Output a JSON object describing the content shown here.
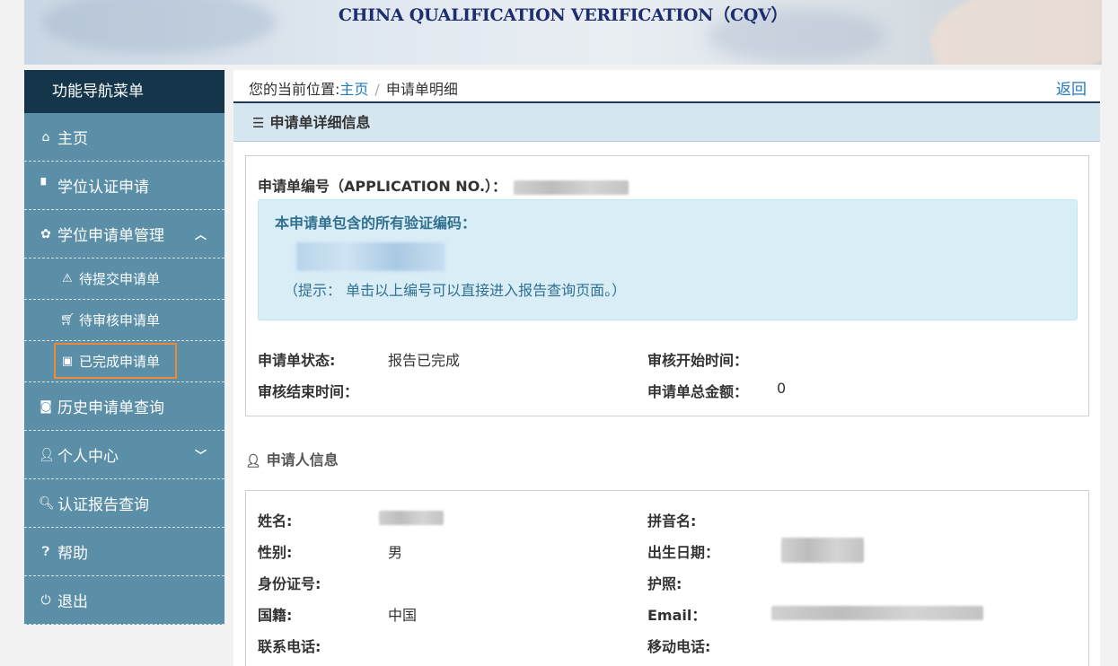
{
  "banner": {
    "title": "CHINA QUALIFICATION VERIFICATION（CQV）"
  },
  "sidebar": {
    "header": "功能导航菜单",
    "items": [
      {
        "label": "主页",
        "icon": "home-icon"
      },
      {
        "label": "学位认证申请",
        "icon": "file-icon"
      },
      {
        "label": "学位申请单管理",
        "icon": "gear-icon"
      },
      {
        "label": "历史申请单查询",
        "icon": "camera-icon"
      },
      {
        "label": "个人中心",
        "icon": "user-icon"
      },
      {
        "label": "认证报告查询",
        "icon": "search-icon"
      },
      {
        "label": "帮助",
        "icon": "question-icon"
      },
      {
        "label": "退出",
        "icon": "power-icon"
      }
    ],
    "sub_items": [
      {
        "label": "待提交申请单",
        "icon": "warning-icon"
      },
      {
        "label": "待审核申请单",
        "icon": "cart-icon"
      },
      {
        "label": "已完成申请单",
        "icon": "briefcase-icon",
        "active": true
      }
    ]
  },
  "breadcrumb": {
    "prefix": "您的当前位置:",
    "home": "主页",
    "sep": "/",
    "current": "申请单明细"
  },
  "back_label": "返回",
  "panel": {
    "title": "申请单详细信息"
  },
  "application": {
    "no_label": "申请单编号（APPLICATION NO.）：",
    "codes_title": "本申请单包含的所有验证编码：",
    "hint": "（提示： 单击以上编号可以直接进入报告查询页面。）",
    "status_label": "申请单状态:",
    "status_value": "报告已完成",
    "start_label": "审核开始时间：",
    "end_label": "审核结束时间：",
    "total_label": "申请单总金额：",
    "total_value": "0"
  },
  "applicant": {
    "title": "申请人信息",
    "name_label": "姓名:",
    "pinyin_label": "拼音名:",
    "gender_label": "性别:",
    "gender_value": "男",
    "birth_label": "出生日期：",
    "id_label": "身份证号:",
    "passport_label": "护照:",
    "nationality_label": "国籍:",
    "nationality_value": "中国",
    "email_label": "Email：",
    "phone_label": "联系电话:",
    "mobile_label": "移动电话:"
  },
  "colors": {
    "sidebar": "#5b8fa8",
    "sidebar_header": "#14354a",
    "highlight": "#ec8a3a",
    "link": "#1f7ab8"
  }
}
